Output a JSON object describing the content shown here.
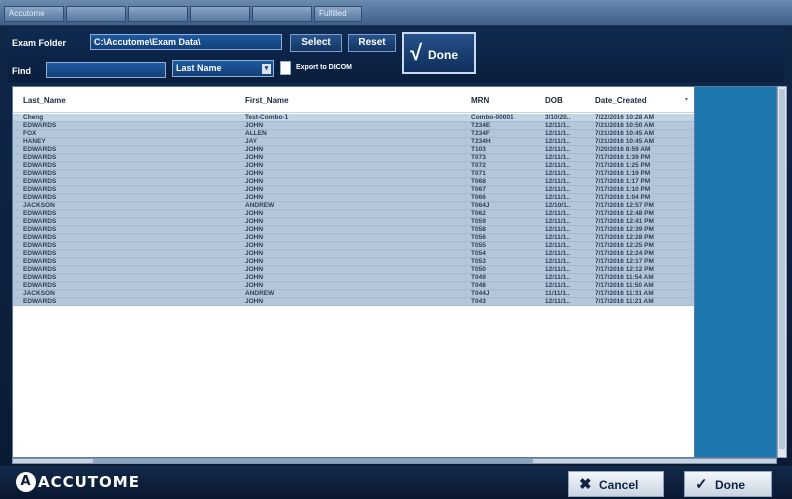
{
  "tabstrip": {
    "tabs": [
      "Accutome",
      "",
      "",
      "",
      "",
      "Fulfilled"
    ]
  },
  "toolbar": {
    "exam_folder_label": "Exam Folder",
    "exam_folder_value": "C:\\Accutome\\Exam Data\\",
    "select_label": "Select",
    "reset_label": "Reset",
    "find_label": "Find",
    "find_value": "",
    "search_field_value": "Last Name",
    "export_label": "Export to DICOM",
    "done_label": "Done"
  },
  "table": {
    "columns": [
      "Last_Name",
      "First_Name",
      "MRN",
      "DOB",
      "Date_Created"
    ],
    "rows": [
      [
        "Cheng",
        "Test-Combo-1",
        "Combo-00001",
        "3/10/20..",
        "7/22/2016 10:28 AM"
      ],
      [
        "EDWARDS",
        "JOHN",
        "T234E",
        "12/11/1..",
        "7/21/2016 10:50 AM"
      ],
      [
        "FOX",
        "ALLEN",
        "T234F",
        "12/11/1..",
        "7/21/2016 10:45 AM"
      ],
      [
        "HANEY",
        "JAY",
        "T234H",
        "12/11/1..",
        "7/21/2016 10:45 AM"
      ],
      [
        "EDWARDS",
        "JOHN",
        "T103",
        "12/11/1..",
        "7/20/2016 8:59 AM"
      ],
      [
        "EDWARDS",
        "JOHN",
        "T073",
        "12/11/1..",
        "7/17/2016 1:39 PM"
      ],
      [
        "EDWARDS",
        "JOHN",
        "T072",
        "12/11/1..",
        "7/17/2016 1:25 PM"
      ],
      [
        "EDWARDS",
        "JOHN",
        "T071",
        "12/11/1..",
        "7/17/2016 1:19 PM"
      ],
      [
        "EDWARDS",
        "JOHN",
        "T068",
        "12/11/1..",
        "7/17/2016 1:17 PM"
      ],
      [
        "EDWARDS",
        "JOHN",
        "T067",
        "12/11/1..",
        "7/17/2016 1:10 PM"
      ],
      [
        "EDWARDS",
        "JOHN",
        "T066",
        "12/11/1..",
        "7/17/2016 1:04 PM"
      ],
      [
        "JACKSON",
        "ANDREW",
        "T064J",
        "12/10/1..",
        "7/17/2016 12:57 PM"
      ],
      [
        "EDWARDS",
        "JOHN",
        "T062",
        "12/11/1..",
        "7/17/2016 12:48 PM"
      ],
      [
        "EDWARDS",
        "JOHN",
        "T059",
        "12/11/1..",
        "7/17/2016 12:41 PM"
      ],
      [
        "EDWARDS",
        "JOHN",
        "T058",
        "12/11/1..",
        "7/17/2016 12:39 PM"
      ],
      [
        "EDWARDS",
        "JOHN",
        "T056",
        "12/11/1..",
        "7/17/2016 12:28 PM"
      ],
      [
        "EDWARDS",
        "JOHN",
        "T055",
        "12/11/1..",
        "7/17/2016 12:25 PM"
      ],
      [
        "EDWARDS",
        "JOHN",
        "T054",
        "12/11/1..",
        "7/17/2016 12:24 PM"
      ],
      [
        "EDWARDS",
        "JOHN",
        "T053",
        "12/11/1..",
        "7/17/2016 12:17 PM"
      ],
      [
        "EDWARDS",
        "JOHN",
        "T050",
        "12/11/1..",
        "7/17/2016 12:12 PM"
      ],
      [
        "EDWARDS",
        "JOHN",
        "T049",
        "12/11/1..",
        "7/17/2016 11:54 AM"
      ],
      [
        "EDWARDS",
        "JOHN",
        "T048",
        "12/11/1..",
        "7/17/2016 11:50 AM"
      ],
      [
        "JACKSON",
        "ANDREW",
        "T044J",
        "11/11/1..",
        "7/17/2016 11:31 AM"
      ],
      [
        "EDWARDS",
        "JOHN",
        "T043",
        "12/11/1..",
        "7/17/2016 11:21 AM"
      ]
    ]
  },
  "bottom": {
    "brand": "ACCUTOME",
    "cancel_label": "Cancel",
    "done_label": "Done"
  },
  "colors": {
    "row_fill": "#b3c6da",
    "side_panel": "#1e78ad",
    "toolbar_bg": "#0f2a52"
  }
}
